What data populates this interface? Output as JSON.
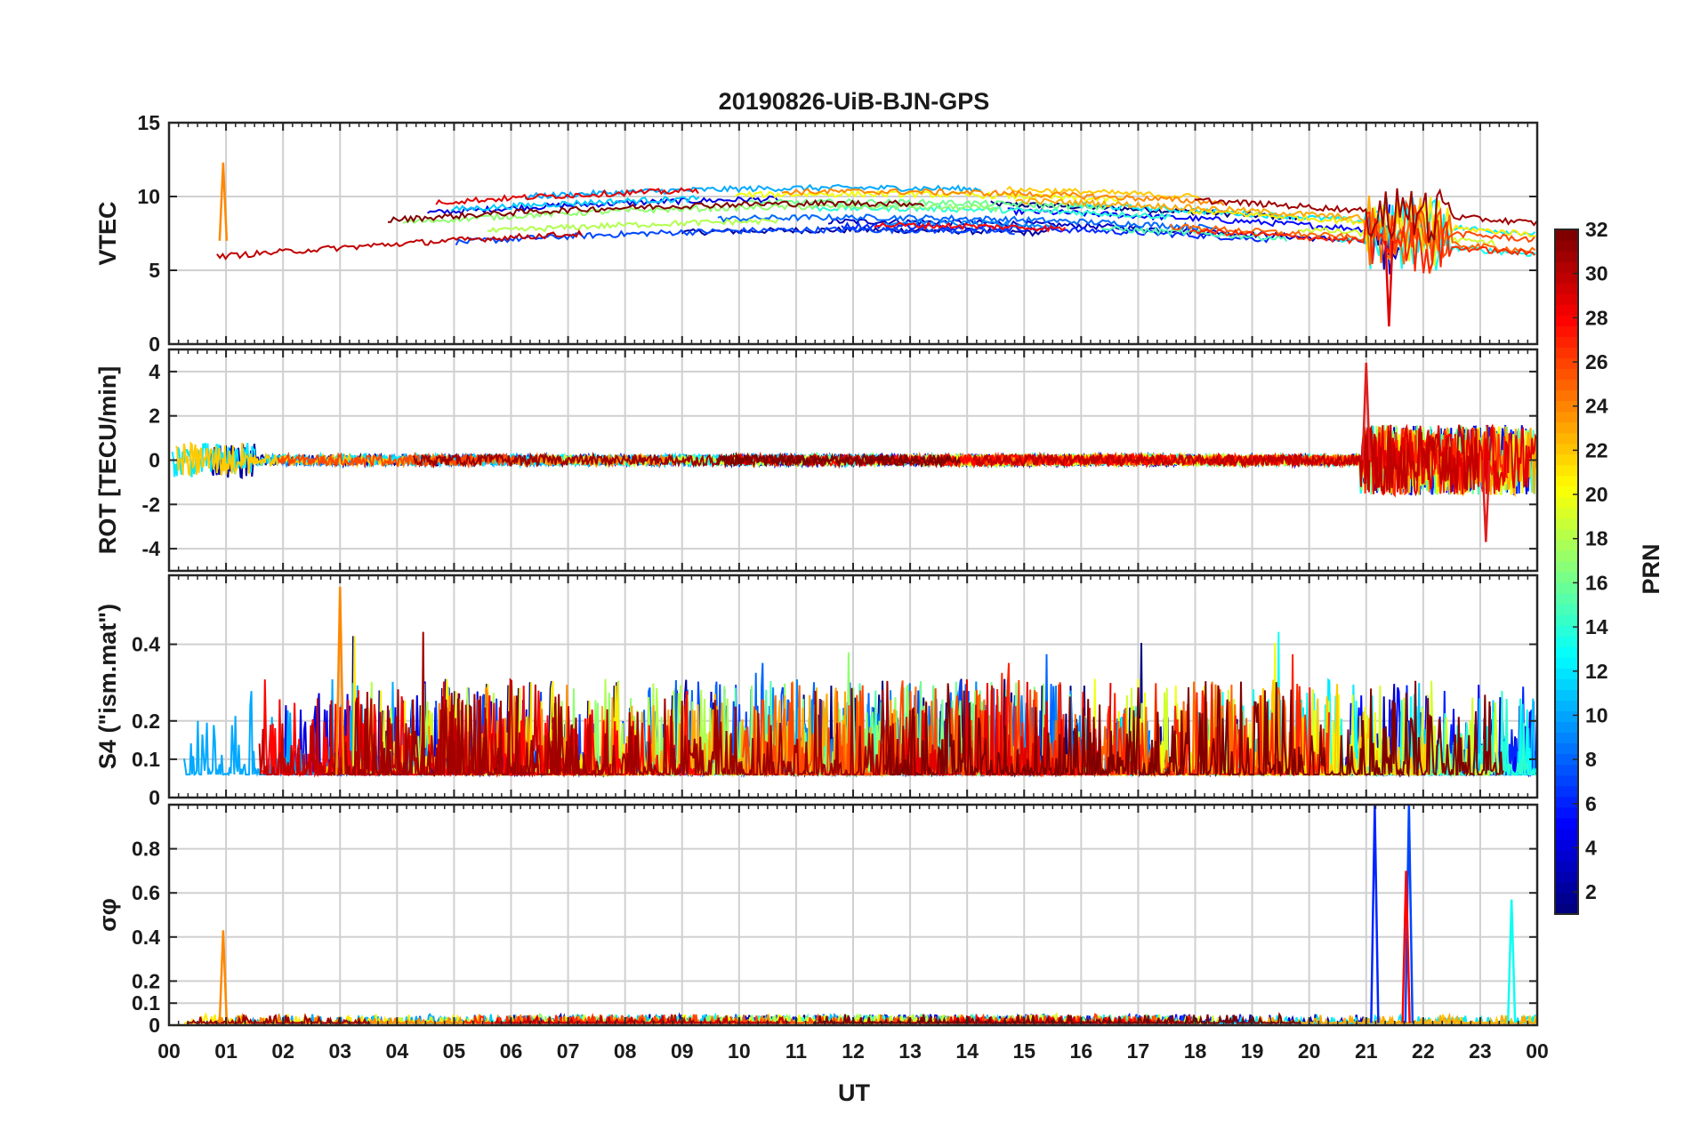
{
  "figure": {
    "title": "20190826-UiB-BJN-GPS",
    "xlabel": "UT",
    "colorbar_label": "PRN"
  },
  "chart_data": [
    {
      "type": "line",
      "ylabel": "VTEC",
      "ylim": [
        0,
        15
      ],
      "yticks": [
        "0",
        "5",
        "10",
        "15"
      ],
      "xlim": [
        0,
        24
      ],
      "grid": true,
      "series_count": 32,
      "description_values": {
        "typical_range": [
          4,
          10
        ],
        "max_peak": {
          "x_hour": 0.95,
          "y": 12.3,
          "prn": 24
        },
        "min_dip": {
          "x_hour": 21.4,
          "y": 1.2,
          "prn": 29
        }
      }
    },
    {
      "type": "line",
      "ylabel": "ROT [TECU/min]",
      "ylim": [
        -5,
        5
      ],
      "yticks": [
        "-4",
        "-2",
        "0",
        "2",
        "4"
      ],
      "xlim": [
        0,
        24
      ],
      "grid": true,
      "series_count": 32,
      "description_values": {
        "baseline": 0,
        "max_peak": {
          "x_hour": 21.0,
          "y": 4.4
        },
        "min_dip": {
          "x_hour": 23.1,
          "y": -3.7
        }
      }
    },
    {
      "type": "line",
      "ylabel": "S4 (\"ism.mat\")",
      "ylim": [
        0,
        0.58
      ],
      "yticks": [
        "0",
        "0.1",
        "0.2",
        "0.4"
      ],
      "xlim": [
        0,
        24
      ],
      "grid": true,
      "series_count": 32,
      "description_values": {
        "baseline": 0.06,
        "max_peak": {
          "x_hour": 3.0,
          "y": 0.55,
          "prn": 24
        }
      }
    },
    {
      "type": "line",
      "ylabel": "σφ",
      "ylim": [
        0,
        1.0
      ],
      "yticks": [
        "0",
        "0.1",
        "0.2",
        "0.4",
        "0.6",
        "0.8"
      ],
      "xlim": [
        0,
        24
      ],
      "grid": true,
      "series_count": 32,
      "description_values": {
        "baseline": 0.02,
        "peaks": [
          {
            "x_hour": 0.95,
            "y": 0.43,
            "prn": 24
          },
          {
            "x_hour": 21.15,
            "y": 1.0,
            "prn": 6
          },
          {
            "x_hour": 21.75,
            "y": 1.0,
            "prn": 7
          },
          {
            "x_hour": 21.7,
            "y": 0.7,
            "prn": 28
          },
          {
            "x_hour": 23.55,
            "y": 0.57,
            "prn": 13
          }
        ]
      }
    }
  ],
  "x_axis": {
    "tick_labels": [
      "00",
      "01",
      "02",
      "03",
      "04",
      "05",
      "06",
      "07",
      "08",
      "09",
      "10",
      "11",
      "12",
      "13",
      "14",
      "15",
      "16",
      "17",
      "18",
      "19",
      "20",
      "21",
      "22",
      "23",
      "00"
    ]
  },
  "colorbar": {
    "range": [
      1,
      32
    ],
    "tick_labels": [
      "2",
      "4",
      "6",
      "8",
      "10",
      "12",
      "14",
      "16",
      "18",
      "20",
      "22",
      "24",
      "26",
      "28",
      "30",
      "32"
    ],
    "colormap": "jet"
  }
}
